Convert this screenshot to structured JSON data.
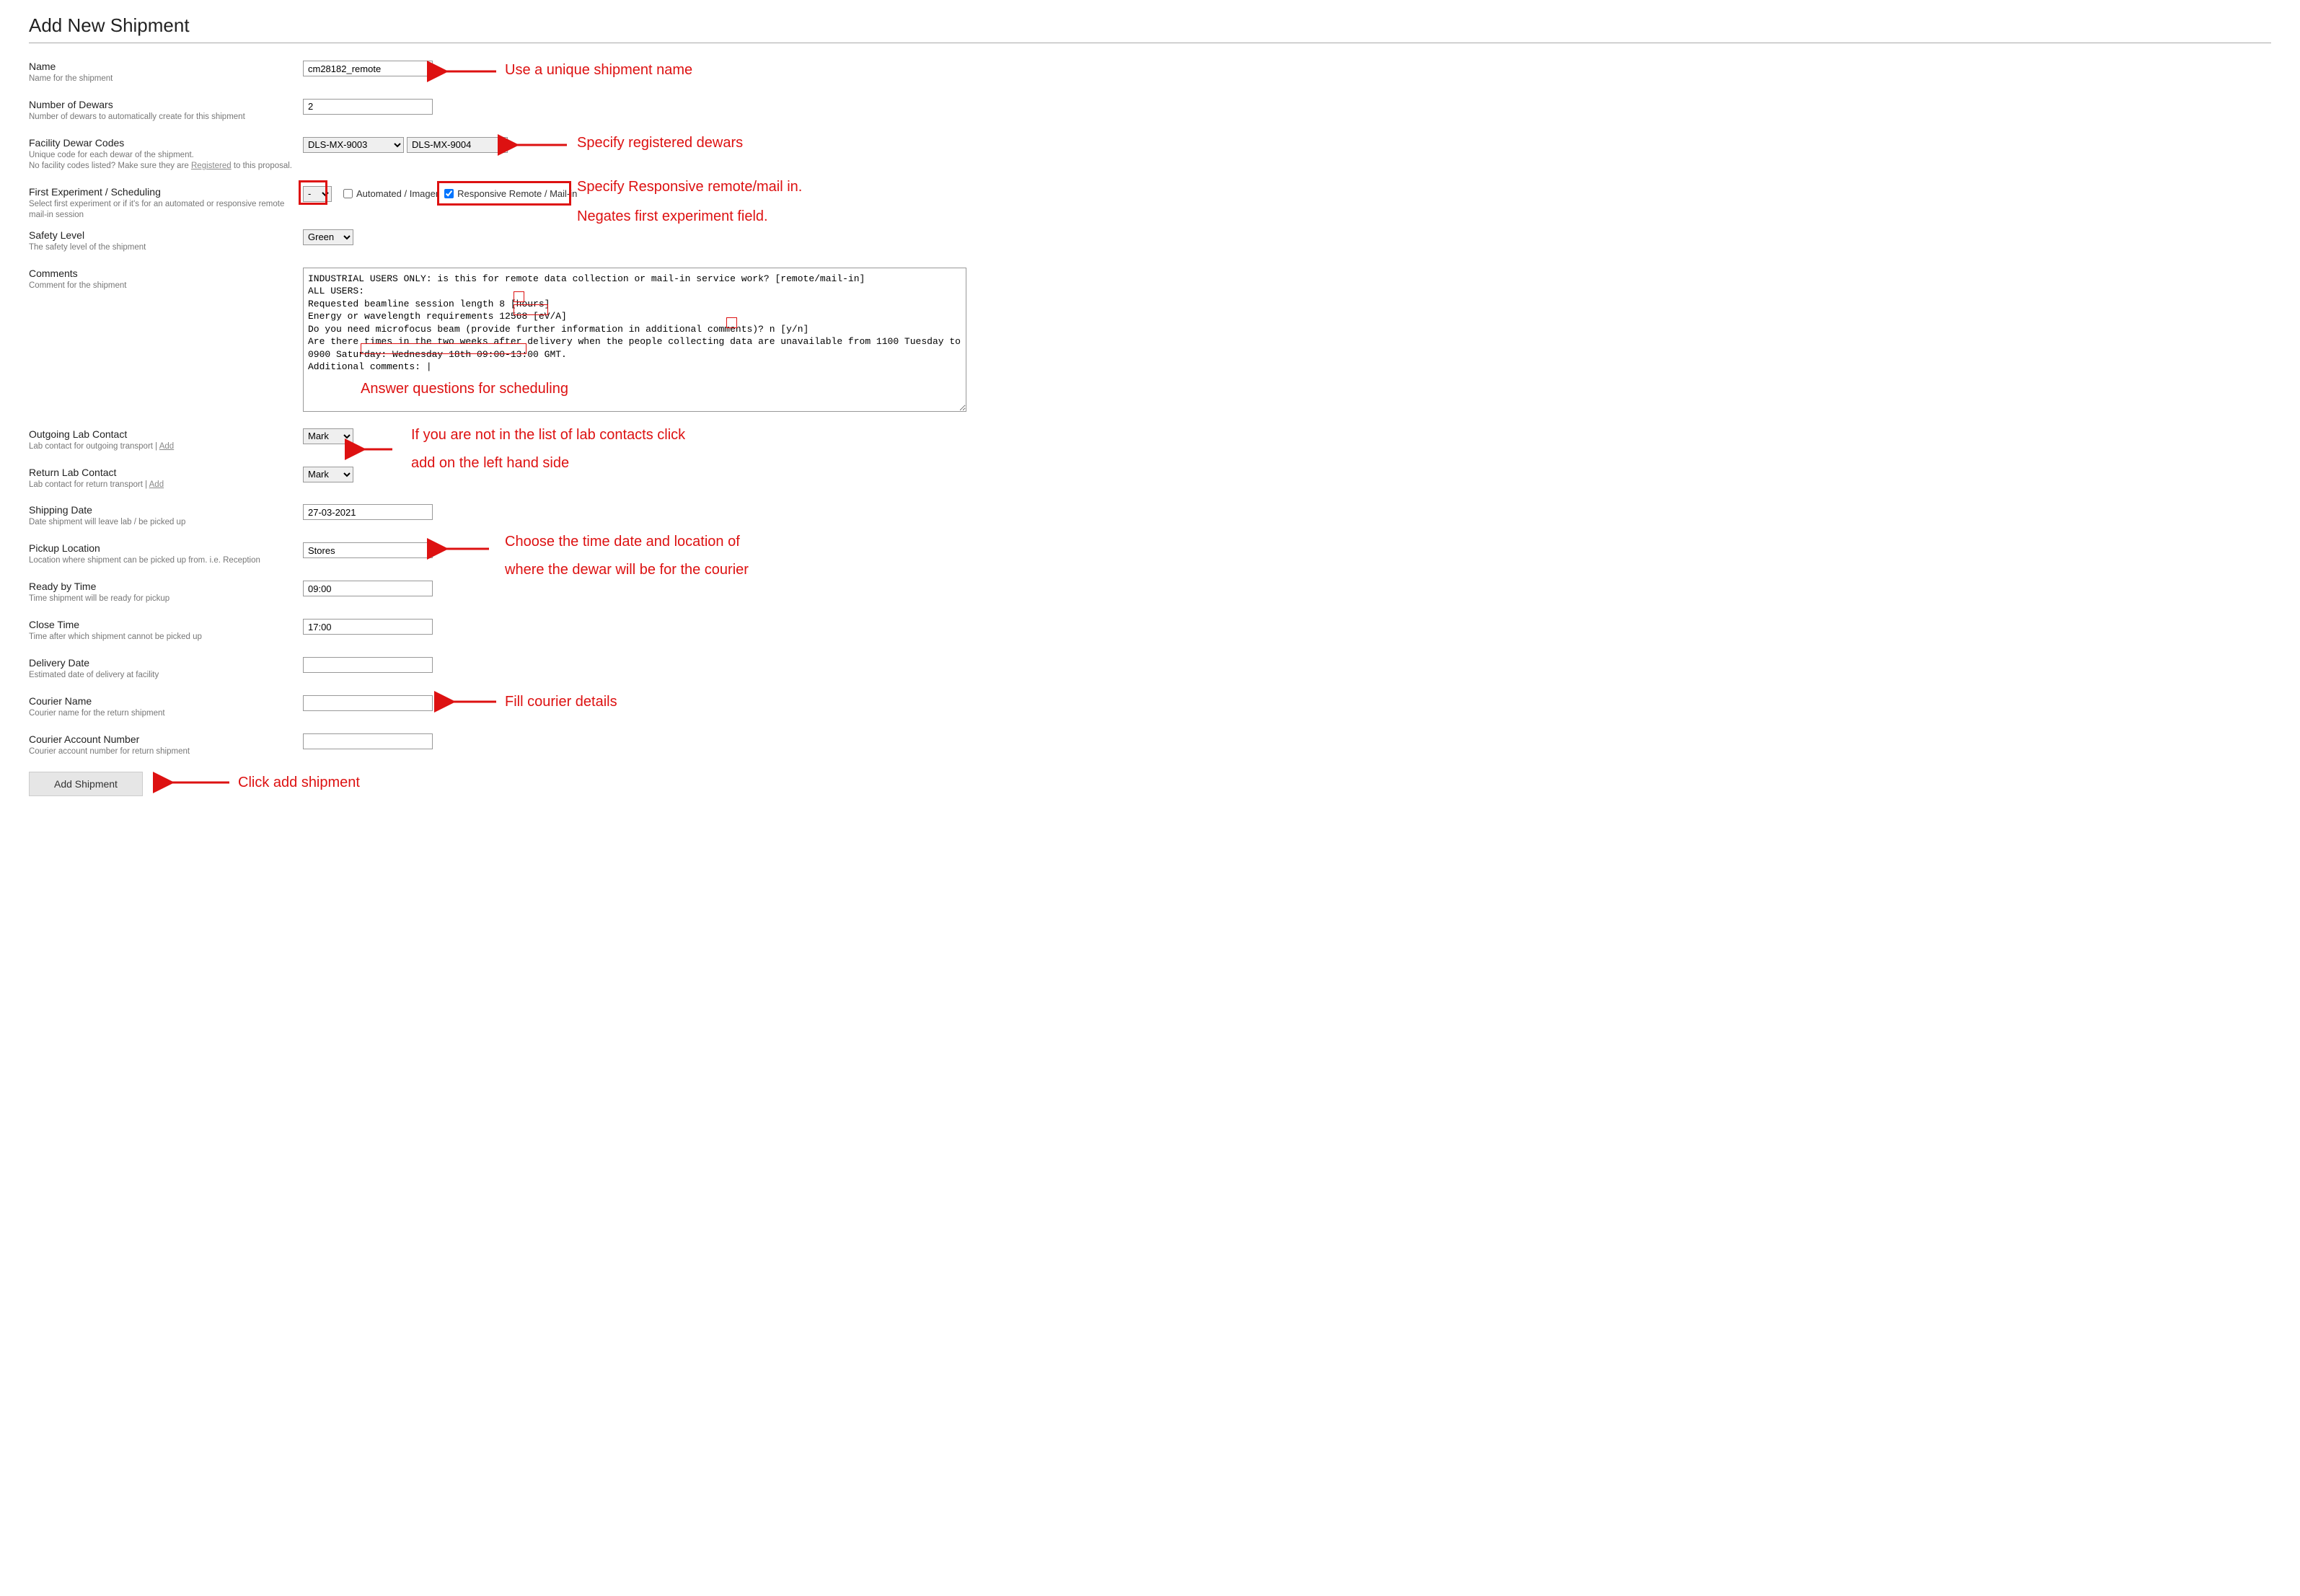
{
  "page": {
    "title": "Add New Shipment"
  },
  "fields": {
    "name": {
      "label": "Name",
      "desc": "Name for the shipment",
      "value": "cm28182_remote"
    },
    "num_dewars": {
      "label": "Number of Dewars",
      "desc": "Number of dewars to automatically create for this shipment",
      "value": "2"
    },
    "facility_codes": {
      "label": "Facility Dewar Codes",
      "desc_a": "Unique code for each dewar of the shipment.",
      "desc_b_pre": "No facility codes listed? Make sure they are ",
      "desc_b_link": "Registered",
      "desc_b_post": " to this proposal.",
      "sel1": "DLS-MX-9003",
      "sel2": "DLS-MX-9004"
    },
    "first_exp": {
      "label": "First Experiment / Scheduling",
      "desc": "Select first experiment or if it's for an automated or responsive remote mail-in session",
      "session": "-",
      "automated_label": "Automated / Imager",
      "automated_checked": false,
      "responsive_label": "Responsive Remote / Mail-in",
      "responsive_checked": true
    },
    "safety": {
      "label": "Safety Level",
      "desc": "The safety level of the shipment",
      "value": "Green"
    },
    "comments": {
      "label": "Comments",
      "desc": "Comment for the shipment",
      "text": "INDUSTRIAL USERS ONLY: is this for remote data collection or mail-in service work? [remote/mail-in]\nALL USERS:\nRequested beamline session length 8 [hours]\nEnergy or wavelength requirements 12568 [eV/A]\nDo you need microfocus beam (provide further information in additional comments)? n [y/n]\nAre there times in the two weeks after delivery when the people collecting data are unavailable from 1100 Tuesday to 0900 Saturday: Wednesday 18th 09:00-13:00 GMT.\nAdditional comments: |"
    },
    "outgoing": {
      "label": "Outgoing Lab Contact",
      "desc_pre": "Lab contact for outgoing transport | ",
      "add": "Add",
      "value": "Mark"
    },
    "return": {
      "label": "Return Lab Contact",
      "desc_pre": "Lab contact for return transport | ",
      "add": "Add",
      "value": "Mark"
    },
    "ship_date": {
      "label": "Shipping Date",
      "desc": "Date shipment will leave lab / be picked up",
      "value": "27-03-2021"
    },
    "pickup": {
      "label": "Pickup Location",
      "desc": "Location where shipment can be picked up from. i.e. Reception",
      "value": "Stores"
    },
    "ready": {
      "label": "Ready by Time",
      "desc": "Time shipment will be ready for pickup",
      "value": "09:00"
    },
    "close": {
      "label": "Close Time",
      "desc": "Time after which shipment cannot be picked up",
      "value": "17:00"
    },
    "deliv_date": {
      "label": "Delivery Date",
      "desc": "Estimated date of delivery at facility",
      "value": ""
    },
    "courier_name": {
      "label": "Courier Name",
      "desc": "Courier name for the return shipment",
      "value": ""
    },
    "courier_acct": {
      "label": "Courier Account Number",
      "desc": "Courier account number for return shipment",
      "value": ""
    }
  },
  "actions": {
    "add_shipment": "Add Shipment"
  },
  "annotations": {
    "name": "Use a unique shipment name",
    "dewars": "Specify registered dewars",
    "responsive_a": "Specify Responsive remote/mail in.",
    "responsive_b": "Negates first experiment field.",
    "comments": "Answer questions for scheduling",
    "labcontact_a": "If you are not in the list of lab contacts click",
    "labcontact_b": "add on the left hand side",
    "date_location_a": "Choose the time date and location of",
    "date_location_b": "where the dewar will be for the courier",
    "courier": "Fill courier details",
    "submit": "Click add shipment"
  }
}
